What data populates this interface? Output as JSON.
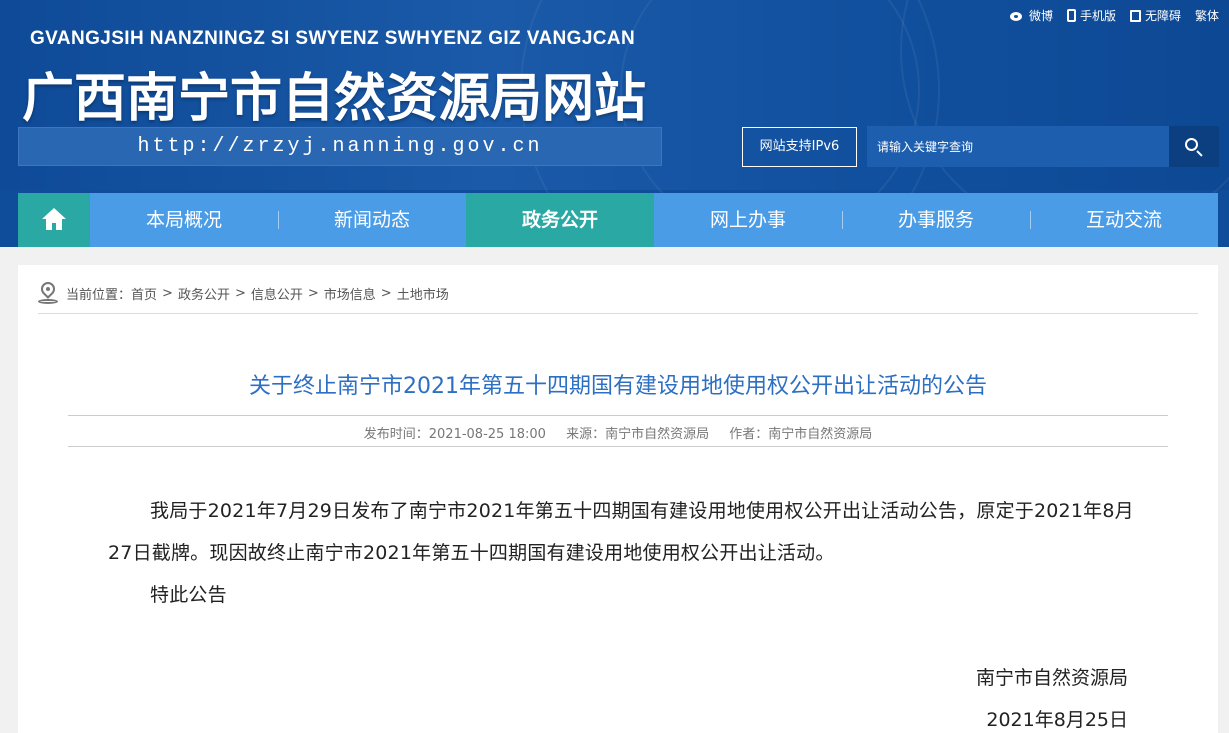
{
  "header": {
    "pinyin": "GVANGJSIH NANZNINGZ SI SWYENZ SWHYENZ GIZ VANGJCAN",
    "title": "广西南宁市自然资源局网站",
    "url": "http://zrzyj.nanning.gov.cn",
    "top_links": [
      {
        "icon": "weibo-icon",
        "label": "微博"
      },
      {
        "icon": "mobile-icon",
        "label": "手机版"
      },
      {
        "icon": "accessibility-icon",
        "label": "无障碍"
      },
      {
        "icon": "",
        "label": "繁体"
      }
    ],
    "ipv6": "网站支持IPv6",
    "search_placeholder": "请输入关键字查询"
  },
  "nav": {
    "items": [
      "本局概况",
      "新闻动态",
      "政务公开",
      "网上办事",
      "办事服务",
      "互动交流"
    ],
    "active": "政务公开"
  },
  "breadcrumb": {
    "prefix": "当前位置：",
    "items": [
      "首页",
      "政务公开",
      "信息公开",
      "市场信息",
      "土地市场"
    ]
  },
  "article": {
    "title": "关于终止南宁市2021年第五十四期国有建设用地使用权公开出让活动的公告",
    "publish_time": "发布时间：2021-08-25 18:00",
    "source": "来源：南宁市自然资源局",
    "author": "作者：南宁市自然资源局",
    "paragraphs": [
      "我局于2021年7月29日发布了南宁市2021年第五十四期国有建设用地使用权公开出让活动公告，原定于2021年8月27日截牌。现因故终止南宁市2021年第五十四期国有建设用地使用权公开出让活动。",
      "特此公告"
    ],
    "sign_org": "南宁市自然资源局",
    "sign_date": "2021年8月25日"
  },
  "colors": {
    "header_bg": "#0f4d9a",
    "nav_bg": "#4a9ce6",
    "nav_active": "#2aa8a4",
    "title_blue": "#2d6fc3"
  }
}
